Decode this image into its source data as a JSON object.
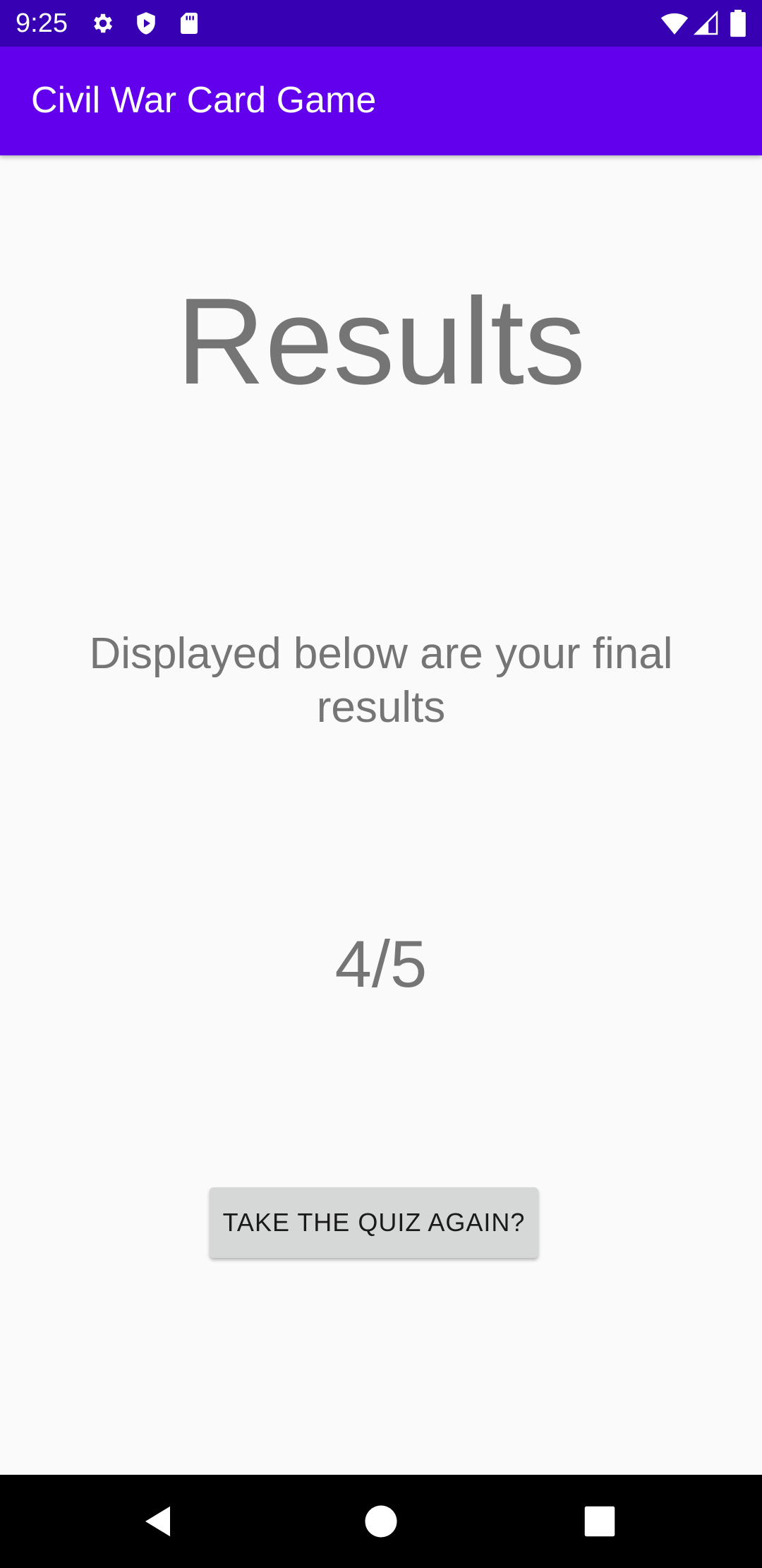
{
  "status_bar": {
    "time": "9:25",
    "left_icons": [
      "gear-icon",
      "shield-play-icon",
      "sd-card-icon"
    ],
    "right_icons": [
      "wifi-icon",
      "cell-signal-icon",
      "battery-icon"
    ],
    "background_color": "#3700b3"
  },
  "app_bar": {
    "title": "Civil War Card Game",
    "background_color": "#6200ee"
  },
  "content": {
    "heading": "Results",
    "description": "Displayed below are your final results",
    "score": "4/5",
    "retake_button_label": "TAKE THE QUIZ AGAIN?",
    "text_color": "#757575",
    "button_color": "#d6d7d7"
  },
  "nav_bar": {
    "buttons": [
      "back-icon",
      "home-icon",
      "recents-icon"
    ]
  }
}
